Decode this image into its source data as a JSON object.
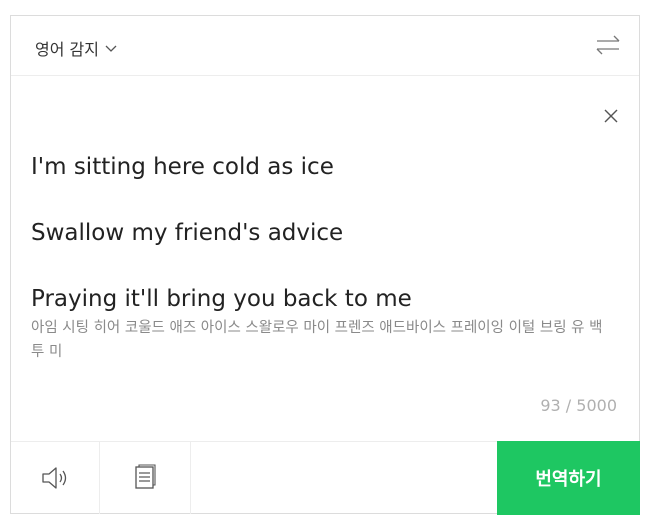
{
  "header": {
    "language_label": "영어 감지",
    "chevron_icon": "chevron-down-icon",
    "swap_icon": "swap-arrows-icon"
  },
  "editor": {
    "close_icon": "close-icon",
    "source_lines": [
      "I'm sitting here cold as ice",
      "Swallow my friend's advice",
      "Praying it'll bring you back to me"
    ],
    "pronunciation": "아임 시팅 히어 코울드 애즈 아이스 스왈로우 마이 프렌즈 애드바이스 프레이잉 이털 브링 유 백 투 미",
    "char_count": "93 / 5000"
  },
  "footer": {
    "speaker_icon": "speaker-icon",
    "memo_icon": "document-icon",
    "translate_label": "번역하기",
    "translate_color": "#1ec762"
  }
}
